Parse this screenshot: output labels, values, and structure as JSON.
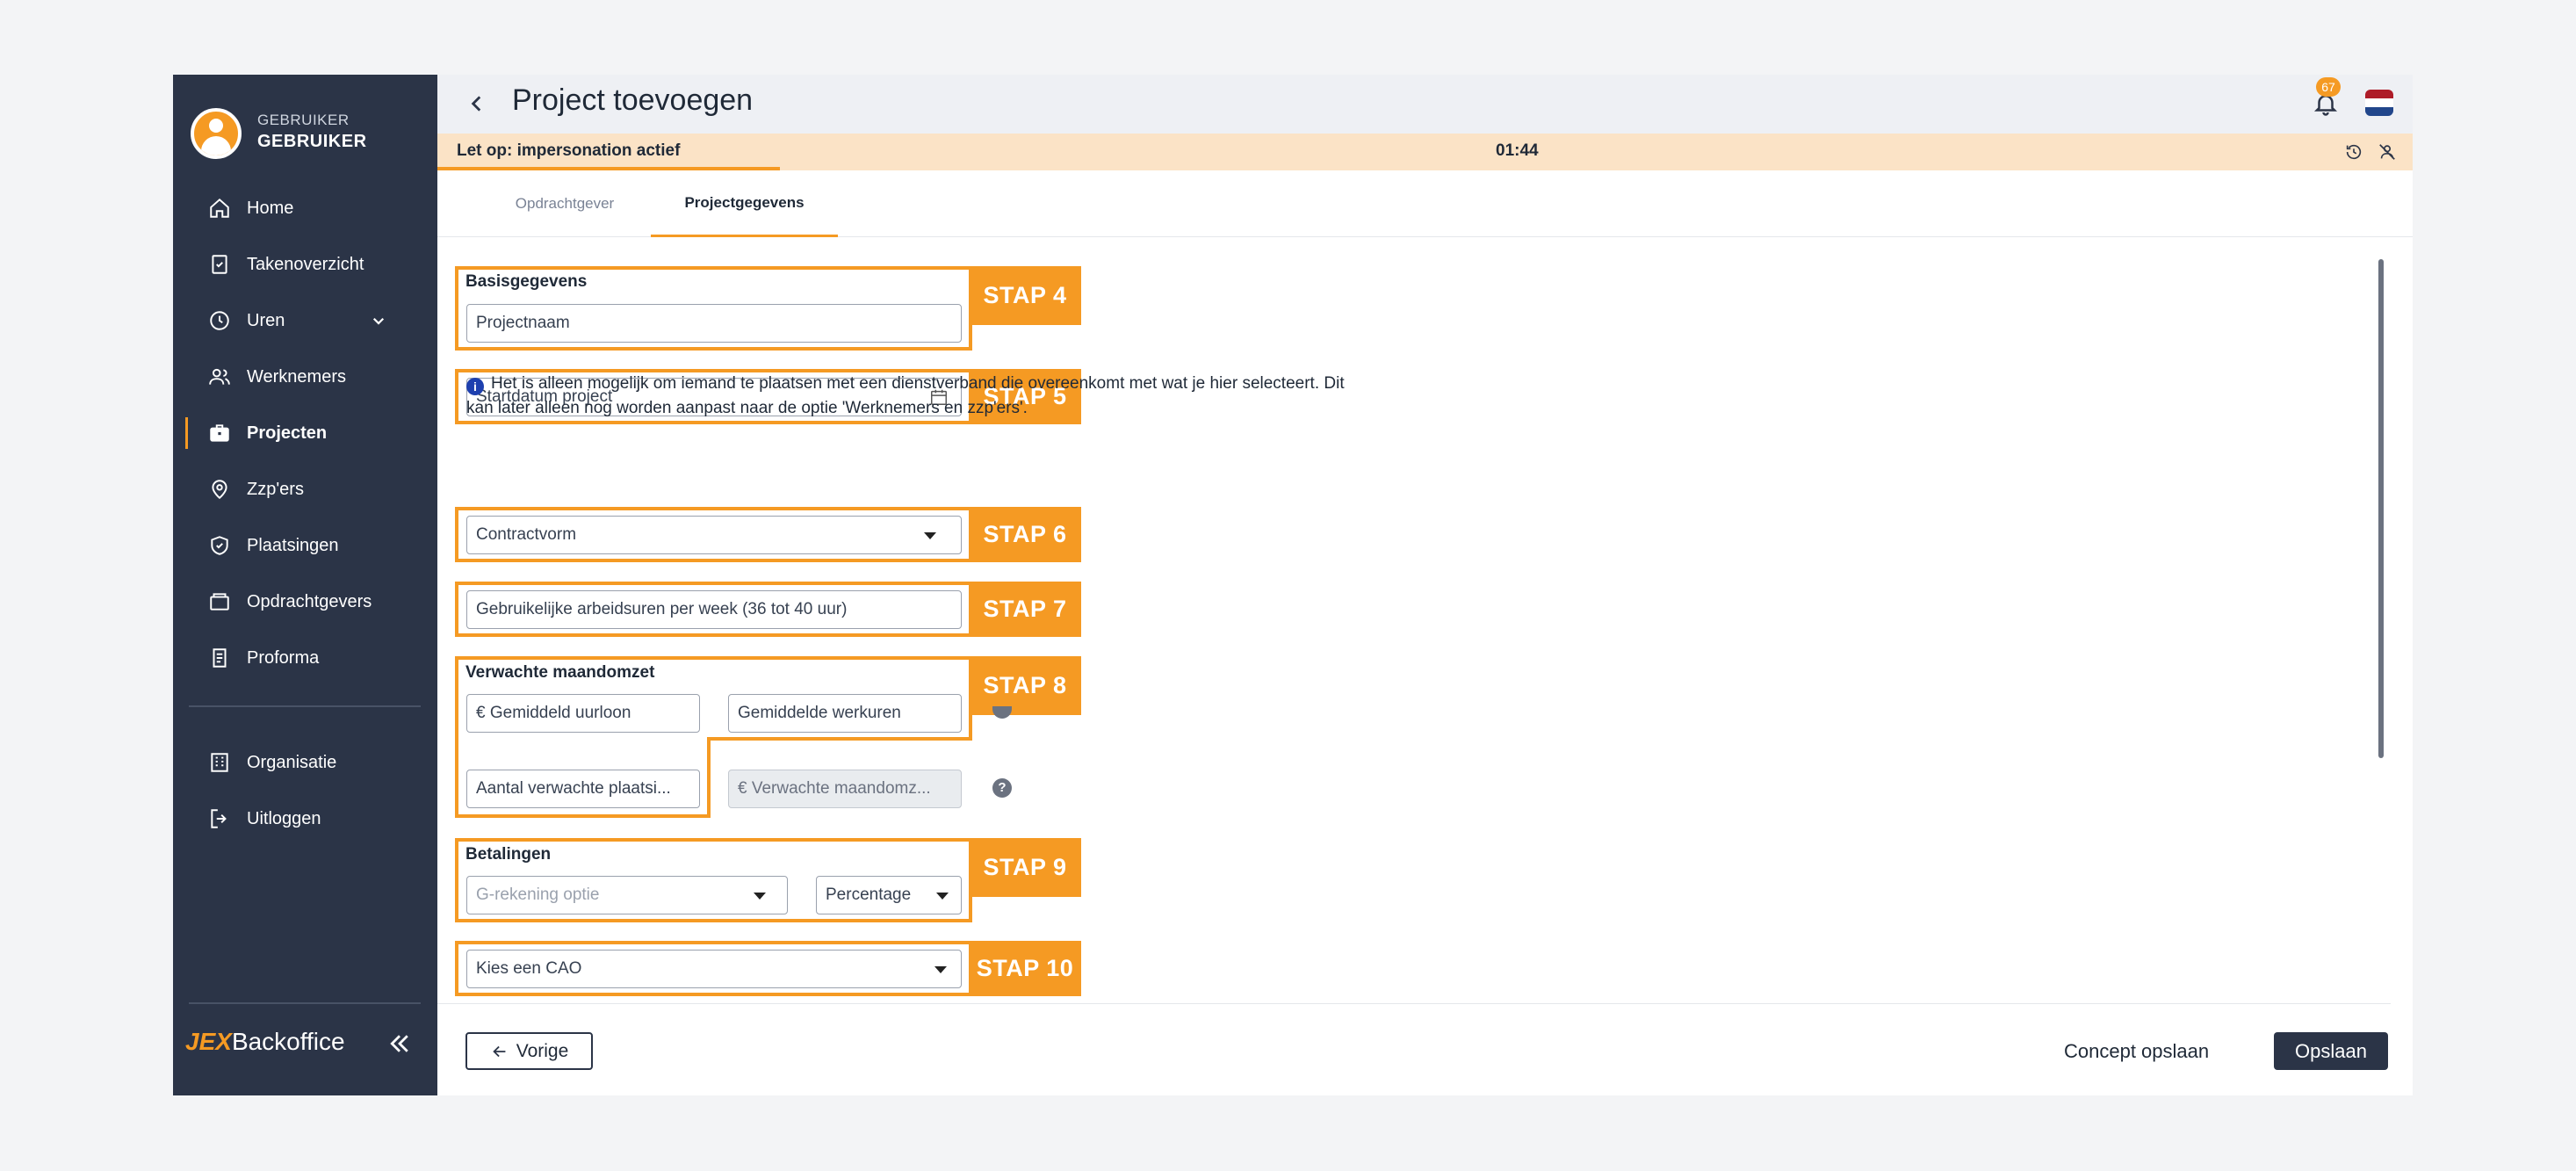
{
  "user": {
    "role": "GEBRUIKER",
    "name": "GEBRUIKER"
  },
  "sidebar": {
    "items": [
      {
        "label": "Home",
        "icon": "home-icon"
      },
      {
        "label": "Takenoverzicht",
        "icon": "clipboard-check-icon"
      },
      {
        "label": "Uren",
        "icon": "clock-icon"
      },
      {
        "label": "Werknemers",
        "icon": "users-icon"
      },
      {
        "label": "Projecten",
        "icon": "briefcase-icon",
        "active": true
      },
      {
        "label": "Zzp'ers",
        "icon": "location-user-icon"
      },
      {
        "label": "Plaatsingen",
        "icon": "shield-check-icon"
      },
      {
        "label": "Opdrachtgevers",
        "icon": "folders-icon"
      },
      {
        "label": "Proforma",
        "icon": "receipt-icon"
      }
    ],
    "bottom_items": [
      {
        "label": "Organisatie",
        "icon": "building-icon"
      },
      {
        "label": "Uitloggen",
        "icon": "logout-icon"
      }
    ],
    "logo_mark": "JEX",
    "logo_text": "Backoffice"
  },
  "header": {
    "title": "Project toevoegen",
    "notification_count": "67"
  },
  "banner": {
    "text": "Let op: impersonation actief",
    "timer": "01:44"
  },
  "tabs": [
    {
      "label": "Opdrachtgever"
    },
    {
      "label": "Projectgegevens",
      "active": true
    }
  ],
  "form": {
    "basis_title": "Basisgegevens",
    "projectnaam": "Projectnaam",
    "startdatum": "Startdatum project",
    "info": "Het is alleen mogelijk om iemand te plaatsen met een dienstverband die overeenkomt met wat je hier selecteert. Dit kan later alleen nog worden aanpast naar de optie 'Werknemers en zzp'ers'.",
    "contractvorm": "Contractvorm",
    "arbeidsuren": "Gebruikelijke arbeidsuren per week (36 tot 40 uur)",
    "omzet_title": "Verwachte maandomzet",
    "uurloon": "€ Gemiddeld uurloon",
    "werkuren": "Gemiddelde werkuren",
    "plaatsingen": "Aantal verwachte plaatsi...",
    "maandomzet": "€ Verwachte maandomz...",
    "betalingen_title": "Betalingen",
    "g_rekening": "G-rekening optie",
    "percentage": "Percentage",
    "cao": "Kies een CAO",
    "help": "?"
  },
  "steps": [
    "STAP 4",
    "STAP 5",
    "STAP 6",
    "STAP 7",
    "STAP 8",
    "STAP 9",
    "STAP 10"
  ],
  "footer": {
    "prev": "Vorige",
    "concept": "Concept opslaan",
    "save": "Opslaan"
  },
  "colors": {
    "accent": "#f59a23",
    "sidebar": "#2b3447",
    "banner": "#fbe3c6"
  }
}
